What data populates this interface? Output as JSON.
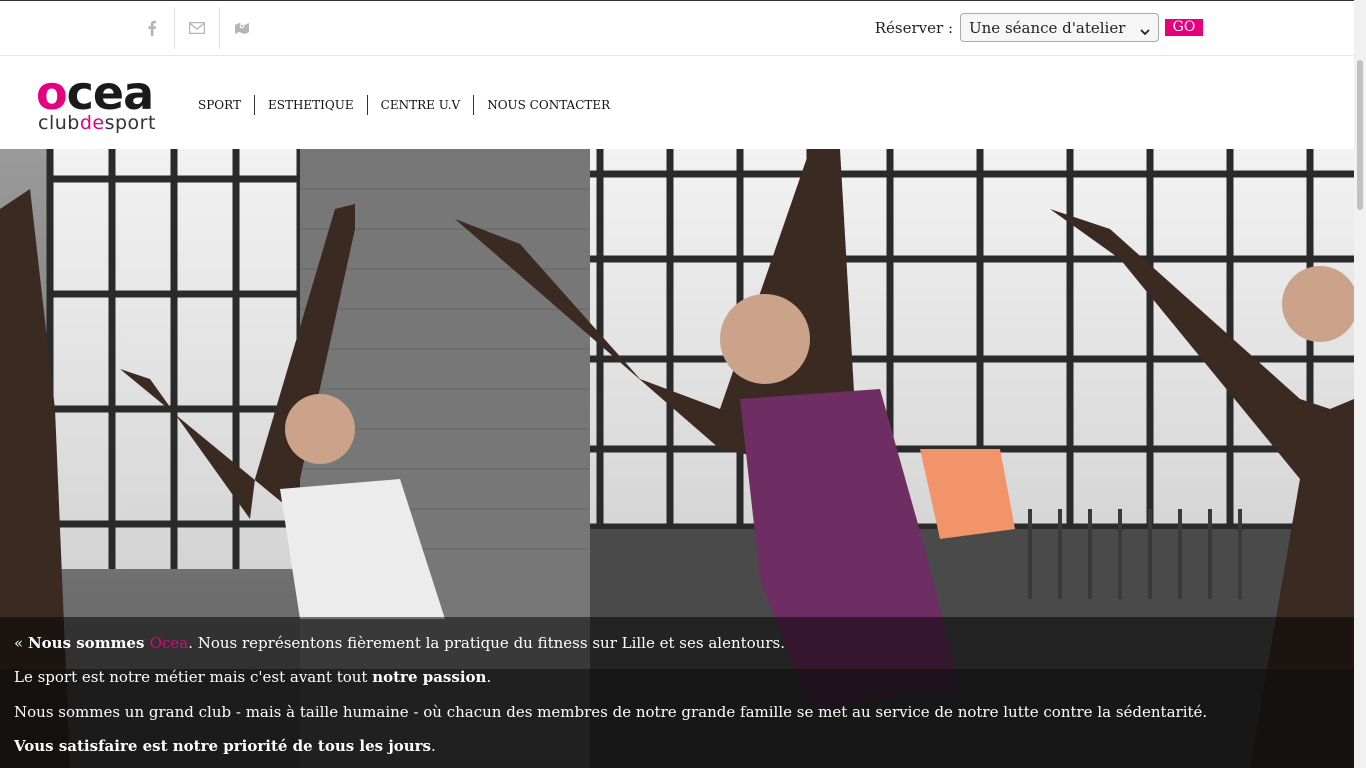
{
  "topbar": {
    "social": [
      {
        "name": "facebook-icon"
      },
      {
        "name": "envelope-icon"
      },
      {
        "name": "map-icon"
      }
    ],
    "reserve_label": "Réserver :",
    "select_value": "Une séance d'atelier",
    "go_label": "GO"
  },
  "logo": {
    "part1": "o",
    "part2": "cea",
    "sub1": "club",
    "sub2": "de",
    "sub3": "sport"
  },
  "nav": [
    {
      "label": "SPORT"
    },
    {
      "label": "ESTHETIQUE"
    },
    {
      "label": "CENTRE U.V"
    },
    {
      "label": "NOUS CONTACTER"
    }
  ],
  "caption": {
    "line1_prefix": "« ",
    "line1_bold": "Nous sommes ",
    "line1_brand": "Ocea",
    "line1_rest": ". Nous représentons fièrement la pratique du fitness sur Lille et ses alentours.",
    "line2_text": "Le sport est notre métier mais c'est avant tout ",
    "line2_bold": "notre passion",
    "line2_end": ".",
    "line3": "Nous sommes un grand club - mais à taille humaine - où chacun des membres de notre grande famille se met au service de notre lutte contre la sédentarité.",
    "line4_bold": "Vous satisfaire est notre priorité de tous les jours",
    "line4_end": "."
  },
  "colors": {
    "brand_pink": "#e6007e"
  }
}
